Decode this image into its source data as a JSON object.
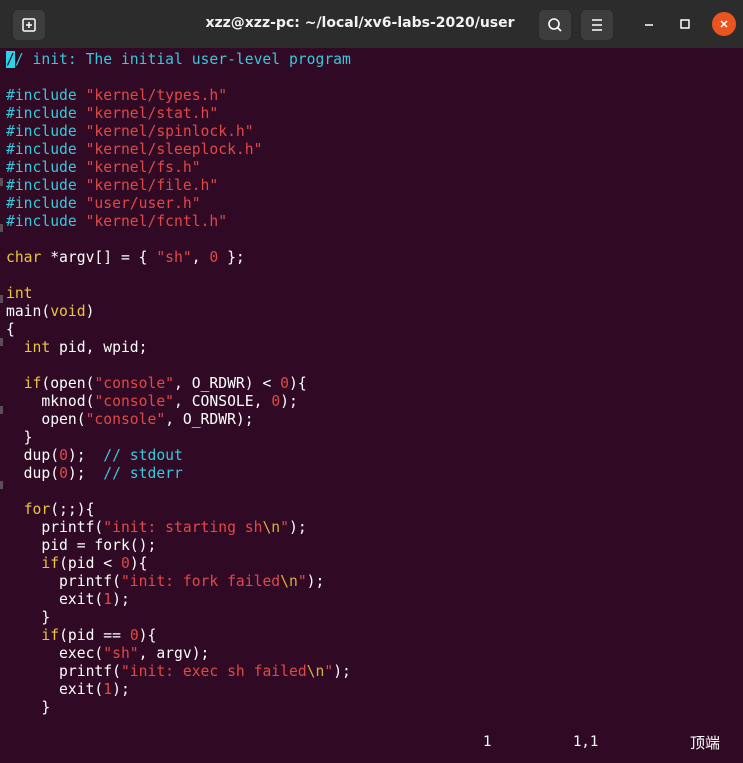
{
  "window": {
    "title": "xzz@xzz-pc: ~/local/xv6-labs-2020/user",
    "buttons": {
      "new_tab_icon": "new-tab-icon",
      "search_icon": "search-icon",
      "menu_icon": "hamburger-menu-icon",
      "minimize_icon": "minimize-icon",
      "maximize_icon": "maximize-icon",
      "close_icon": "close-icon"
    },
    "accent_color": "#e95420"
  },
  "terminal": {
    "background": "#300a24",
    "lines": [
      [
        [
          "cursor",
          "/"
        ],
        [
          "c-comment",
          "/ init: The initial user-level program"
        ]
      ],
      [],
      [
        [
          "c-pre",
          "#include "
        ],
        [
          "c-str",
          "\"kernel/types.h\""
        ]
      ],
      [
        [
          "c-pre",
          "#include "
        ],
        [
          "c-str",
          "\"kernel/stat.h\""
        ]
      ],
      [
        [
          "c-pre",
          "#include "
        ],
        [
          "c-str",
          "\"kernel/spinlock.h\""
        ]
      ],
      [
        [
          "c-pre",
          "#include "
        ],
        [
          "c-str",
          "\"kernel/sleeplock.h\""
        ]
      ],
      [
        [
          "c-pre",
          "#include "
        ],
        [
          "c-str",
          "\"kernel/fs.h\""
        ]
      ],
      [
        [
          "c-pre",
          "#include "
        ],
        [
          "c-str",
          "\"kernel/file.h\""
        ]
      ],
      [
        [
          "c-pre",
          "#include "
        ],
        [
          "c-str",
          "\"user/user.h\""
        ]
      ],
      [
        [
          "c-pre",
          "#include "
        ],
        [
          "c-str",
          "\"kernel/fcntl.h\""
        ]
      ],
      [],
      [
        [
          "c-type",
          "char"
        ],
        [
          "c-plain",
          " *argv[] = { "
        ],
        [
          "c-str",
          "\"sh\""
        ],
        [
          "c-plain",
          ", "
        ],
        [
          "c-num",
          "0"
        ],
        [
          "c-plain",
          " };"
        ]
      ],
      [],
      [
        [
          "c-type",
          "int"
        ]
      ],
      [
        [
          "c-plain",
          "main("
        ],
        [
          "c-type",
          "void"
        ],
        [
          "c-plain",
          ")"
        ]
      ],
      [
        [
          "c-plain",
          "{"
        ]
      ],
      [
        [
          "c-plain",
          "  "
        ],
        [
          "c-type",
          "int"
        ],
        [
          "c-plain",
          " pid, wpid;"
        ]
      ],
      [],
      [
        [
          "c-plain",
          "  "
        ],
        [
          "c-kw",
          "if"
        ],
        [
          "c-plain",
          "(open("
        ],
        [
          "c-str",
          "\"console\""
        ],
        [
          "c-plain",
          ", O_RDWR) < "
        ],
        [
          "c-num",
          "0"
        ],
        [
          "c-plain",
          "){"
        ]
      ],
      [
        [
          "c-plain",
          "    mknod("
        ],
        [
          "c-str",
          "\"console\""
        ],
        [
          "c-plain",
          ", CONSOLE, "
        ],
        [
          "c-num",
          "0"
        ],
        [
          "c-plain",
          ");"
        ]
      ],
      [
        [
          "c-plain",
          "    open("
        ],
        [
          "c-str",
          "\"console\""
        ],
        [
          "c-plain",
          ", O_RDWR);"
        ]
      ],
      [
        [
          "c-plain",
          "  }"
        ]
      ],
      [
        [
          "c-plain",
          "  dup("
        ],
        [
          "c-num",
          "0"
        ],
        [
          "c-plain",
          ");  "
        ],
        [
          "c-comment",
          "// stdout"
        ]
      ],
      [
        [
          "c-plain",
          "  dup("
        ],
        [
          "c-num",
          "0"
        ],
        [
          "c-plain",
          ");  "
        ],
        [
          "c-comment",
          "// stderr"
        ]
      ],
      [],
      [
        [
          "c-plain",
          "  "
        ],
        [
          "c-kw",
          "for"
        ],
        [
          "c-plain",
          "(;;){"
        ]
      ],
      [
        [
          "c-plain",
          "    printf("
        ],
        [
          "c-str",
          "\"init: starting sh"
        ],
        [
          "c-esc",
          "\\n"
        ],
        [
          "c-str",
          "\""
        ],
        [
          "c-plain",
          ");"
        ]
      ],
      [
        [
          "c-plain",
          "    pid = fork();"
        ]
      ],
      [
        [
          "c-plain",
          "    "
        ],
        [
          "c-kw",
          "if"
        ],
        [
          "c-plain",
          "(pid < "
        ],
        [
          "c-num",
          "0"
        ],
        [
          "c-plain",
          "){"
        ]
      ],
      [
        [
          "c-plain",
          "      printf("
        ],
        [
          "c-str",
          "\"init: fork failed"
        ],
        [
          "c-esc",
          "\\n"
        ],
        [
          "c-str",
          "\""
        ],
        [
          "c-plain",
          ");"
        ]
      ],
      [
        [
          "c-plain",
          "      exit("
        ],
        [
          "c-num",
          "1"
        ],
        [
          "c-plain",
          ");"
        ]
      ],
      [
        [
          "c-plain",
          "    }"
        ]
      ],
      [
        [
          "c-plain",
          "    "
        ],
        [
          "c-kw",
          "if"
        ],
        [
          "c-plain",
          "(pid == "
        ],
        [
          "c-num",
          "0"
        ],
        [
          "c-plain",
          "){"
        ]
      ],
      [
        [
          "c-plain",
          "      exec("
        ],
        [
          "c-str",
          "\"sh\""
        ],
        [
          "c-plain",
          ", argv);"
        ]
      ],
      [
        [
          "c-plain",
          "      printf("
        ],
        [
          "c-str",
          "\"init: exec sh failed"
        ],
        [
          "c-esc",
          "\\n"
        ],
        [
          "c-str",
          "\""
        ],
        [
          "c-plain",
          ");"
        ]
      ],
      [
        [
          "c-plain",
          "      exit("
        ],
        [
          "c-num",
          "1"
        ],
        [
          "c-plain",
          ");"
        ]
      ],
      [
        [
          "c-plain",
          "    }"
        ]
      ]
    ],
    "status": {
      "line_count": "1",
      "cursor_position": "1,1",
      "scroll_position": "顶端"
    }
  }
}
